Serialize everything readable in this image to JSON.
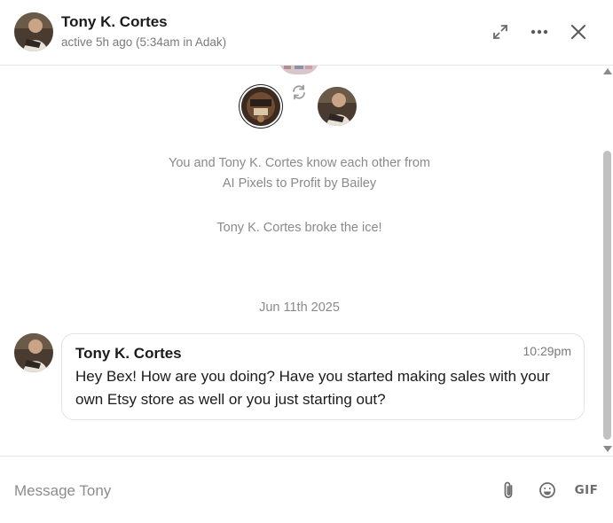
{
  "header": {
    "name": "Tony K. Cortes",
    "status": "active 5h ago (5:34am in Adak)",
    "icons": {
      "expand": "expand-arrows-icon",
      "more": "more-dots-icon",
      "close": "close-x-icon"
    }
  },
  "intro": {
    "line1": "You and Tony K. Cortes know each other from",
    "line2": "AI Pixels to Profit by Bailey",
    "ice": "Tony K. Cortes broke the ice!",
    "swap_icon": "swap-refresh-icon"
  },
  "date_separator": "Jun 11th 2025",
  "messages": [
    {
      "author": "Tony K. Cortes",
      "time": "10:29pm",
      "text": "Hey Bex! How are you doing? Have you started making sales with your own Etsy store as well or you just starting out?"
    }
  ],
  "composer": {
    "placeholder": "Message Tony",
    "gif_label": "GIF",
    "icons": {
      "attach": "paperclip-icon",
      "emoji": "smiley-icon"
    }
  },
  "colors": {
    "muted_text": "#8a8a8a",
    "border": "#e3e3e3",
    "icon": "#6c6c6c"
  }
}
